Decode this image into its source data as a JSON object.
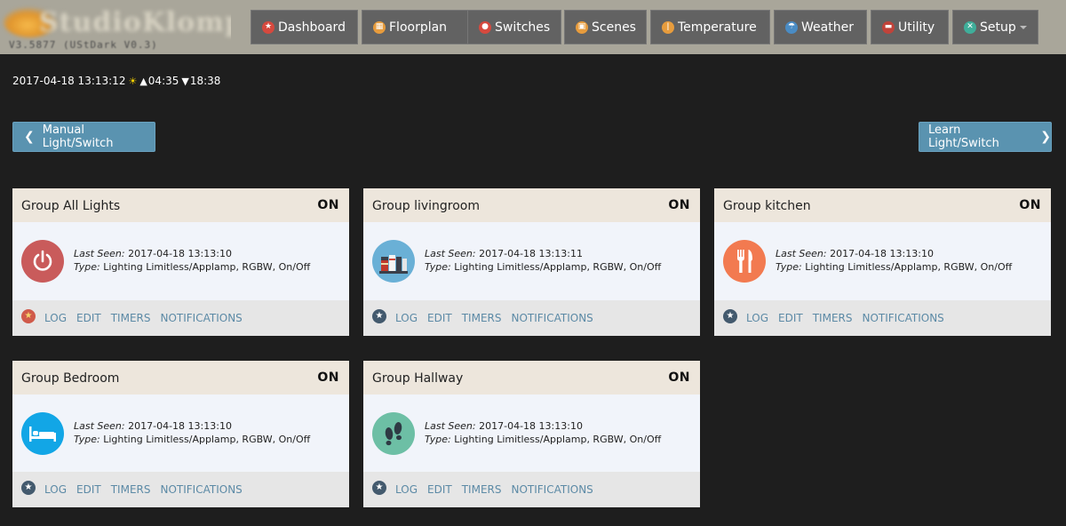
{
  "app": {
    "logo_text": "StudioKlomp",
    "version": "V3.5877 (UStDark V0.3)"
  },
  "nav": [
    {
      "label": "Dashboard",
      "icon": "star-icon",
      "color": "#d6493e",
      "glyph": "★"
    },
    {
      "label": "Floorplan",
      "icon": "floorplan-icon",
      "color": "#e79c3d",
      "glyph": "▦"
    },
    {
      "label": "Switches",
      "icon": "bulb-icon",
      "color": "#d6493e",
      "glyph": "●"
    },
    {
      "label": "Scenes",
      "icon": "scenes-icon",
      "color": "#e79c3d",
      "glyph": "▣"
    },
    {
      "label": "Temperature",
      "icon": "thermometer-icon",
      "color": "#e79c3d",
      "glyph": "ǀ"
    },
    {
      "label": "Weather",
      "icon": "weather-icon",
      "color": "#4a8cc4",
      "glyph": "☂"
    },
    {
      "label": "Utility",
      "icon": "utility-icon",
      "color": "#c0433a",
      "glyph": "▬"
    },
    {
      "label": "Setup",
      "icon": "setup-icon",
      "color": "#3fae9a",
      "glyph": "✕"
    }
  ],
  "info": {
    "datetime": "2017-04-18 13:13:12",
    "sunrise": "04:35",
    "sunset": "18:38"
  },
  "buttons": {
    "prev_label": "Manual Light/Switch",
    "next_label": "Learn Light/Switch"
  },
  "labels": {
    "last_seen": "Last Seen:",
    "type": "Type:"
  },
  "footer_links": {
    "log": "LOG",
    "edit": "EDIT",
    "timers": "TIMERS",
    "notifications": "NOTIFICATIONS"
  },
  "cards": [
    {
      "title": "Group All Lights",
      "status": "ON",
      "last_seen": "2017-04-18 13:13:10",
      "type": "Lighting Limitless/Applamp, RGBW, On/Off",
      "icon": "power-icon",
      "icon_color": "#c95b5b",
      "favorite": true
    },
    {
      "title": "Group livingroom",
      "status": "ON",
      "last_seen": "2017-04-18 13:13:11",
      "type": "Lighting Limitless/Applamp, RGBW, On/Off",
      "icon": "books-icon",
      "icon_color": "#6ab0d6",
      "favorite": false
    },
    {
      "title": "Group kitchen",
      "status": "ON",
      "last_seen": "2017-04-18 13:13:10",
      "type": "Lighting Limitless/Applamp, RGBW, On/Off",
      "icon": "fork-knife-icon",
      "icon_color": "#f27a50",
      "favorite": false
    },
    {
      "title": "Group Bedroom",
      "status": "ON",
      "last_seen": "2017-04-18 13:13:10",
      "type": "Lighting Limitless/Applamp, RGBW, On/Off",
      "icon": "bed-icon",
      "icon_color": "#12a6e6",
      "favorite": false
    },
    {
      "title": "Group Hallway",
      "status": "ON",
      "last_seen": "2017-04-18 13:13:10",
      "type": "Lighting Limitless/Applamp, RGBW, On/Off",
      "icon": "footsteps-icon",
      "icon_color": "#6dbfa5",
      "favorite": false
    }
  ]
}
